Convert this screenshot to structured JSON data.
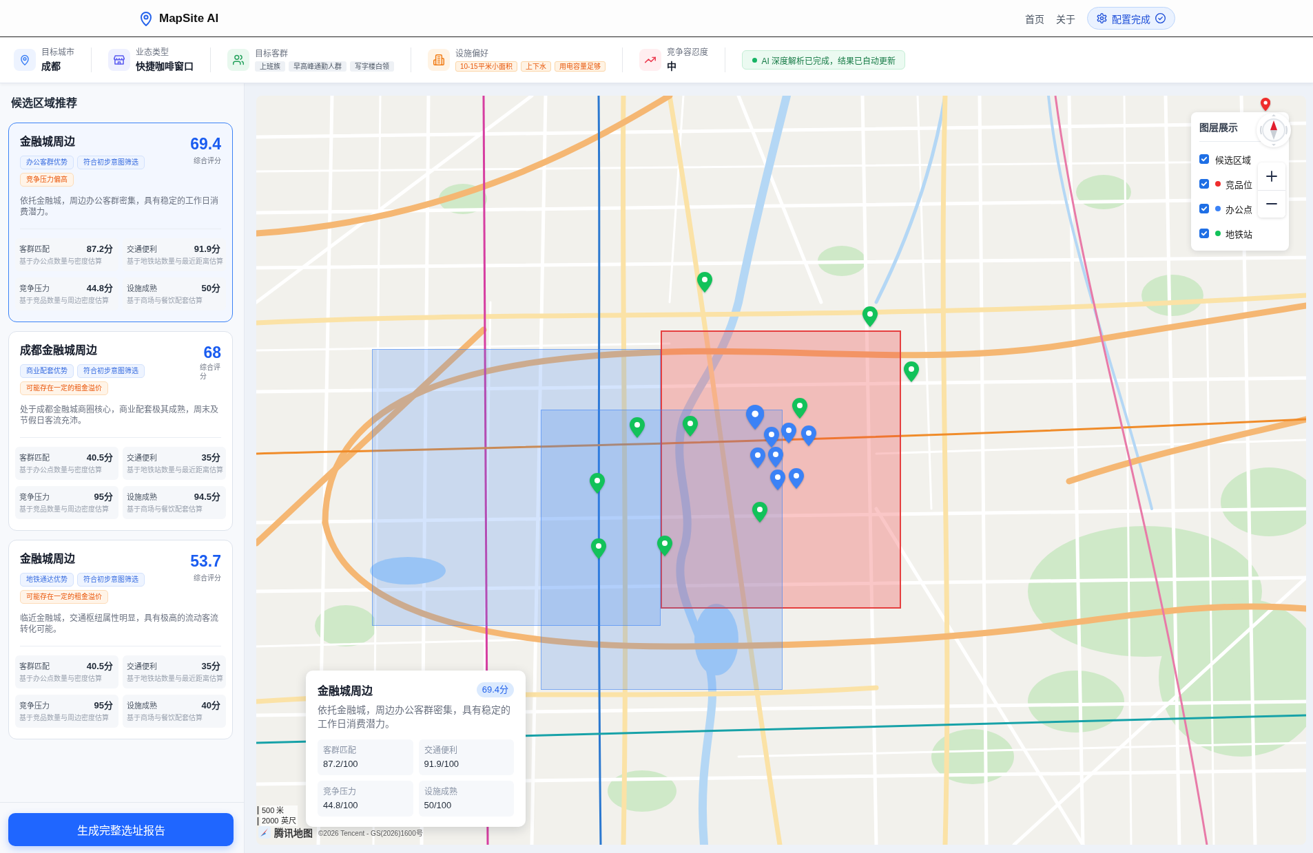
{
  "header": {
    "logo": "MapSite AI",
    "nav": [
      "首页",
      "关于"
    ],
    "status_button": "配置完成"
  },
  "summary_bar": {
    "items": [
      {
        "kind": "value",
        "label": "目标城市",
        "value": "成都"
      },
      {
        "kind": "value",
        "label": "业态类型",
        "value": "快捷咖啡窗口"
      },
      {
        "kind": "tags",
        "label": "目标客群",
        "tags": [
          "上班族",
          "早高峰通勤人群",
          "写字楼白领"
        ]
      },
      {
        "kind": "tags",
        "label": "设施偏好",
        "tags": [
          "10-15平米小面积",
          "上下水",
          "用电容量足够"
        ]
      },
      {
        "kind": "value",
        "label": "竞争容忍度",
        "value": "中"
      }
    ],
    "status": "AI 深度解析已完成，结果已自动更新"
  },
  "sidebar": {
    "title": "候选区域推荐",
    "cards": [
      {
        "selected": true,
        "title": "金融城周边",
        "score": "69.4",
        "score_label": "综合评分",
        "tags": [
          {
            "text": "办公客群优势",
            "kind": "highlight"
          },
          {
            "text": "符合初步意图筛选",
            "kind": "highlight"
          },
          {
            "text": "竞争压力偏高",
            "kind": "warning"
          }
        ],
        "description": "依托金融城，周边办公客群密集，具有稳定的工作日消费潜力。",
        "metrics": [
          {
            "label": "客群匹配",
            "value": "87.2分",
            "note": "基于办公点数量与密度估算"
          },
          {
            "label": "交通便利",
            "value": "91.9分",
            "note": "基于地铁站数量与最近距离估算"
          },
          {
            "label": "竞争压力",
            "value": "44.8分",
            "note": "基于竞品数量与周边密度估算"
          },
          {
            "label": "设施成熟",
            "value": "50分",
            "note": "基于商场与餐饮配套估算"
          }
        ]
      },
      {
        "selected": false,
        "title": "成都金融城周边",
        "score": "68",
        "score_label": "综合评分",
        "tags": [
          {
            "text": "商业配套优势",
            "kind": "highlight"
          },
          {
            "text": "符合初步意图筛选",
            "kind": "highlight"
          },
          {
            "text": "可能存在一定的租金溢价",
            "kind": "warning"
          }
        ],
        "description": "处于成都金融城商圈核心，商业配套极其成熟，周末及节假日客流充沛。",
        "metrics": [
          {
            "label": "客群匹配",
            "value": "40.5分",
            "note": "基于办公点数量与密度估算"
          },
          {
            "label": "交通便利",
            "value": "35分",
            "note": "基于地铁站数量与最近距离估算"
          },
          {
            "label": "竞争压力",
            "value": "95分",
            "note": "基于竞品数量与周边密度估算"
          },
          {
            "label": "设施成熟",
            "value": "94.5分",
            "note": "基于商场与餐饮配套估算"
          }
        ]
      },
      {
        "selected": false,
        "title": "金融城周边",
        "score": "53.7",
        "score_label": "综合评分",
        "tags": [
          {
            "text": "地铁通达优势",
            "kind": "highlight"
          },
          {
            "text": "符合初步意图筛选",
            "kind": "highlight"
          },
          {
            "text": "可能存在一定的租金溢价",
            "kind": "warning"
          }
        ],
        "description": "临近金融城，交通枢纽属性明显，具有极高的流动客流转化可能。",
        "metrics": [
          {
            "label": "客群匹配",
            "value": "40.5分",
            "note": "基于办公点数量与密度估算"
          },
          {
            "label": "交通便利",
            "value": "35分",
            "note": "基于地铁站数量与最近距离估算"
          },
          {
            "label": "竞争压力",
            "value": "95分",
            "note": "基于竞品数量与周边密度估算"
          },
          {
            "label": "设施成熟",
            "value": "40分",
            "note": "基于商场与餐饮配套估算"
          }
        ]
      }
    ],
    "report_button": "生成完整选址报告"
  },
  "map": {
    "layer_panel": {
      "title": "图层展示",
      "layers": [
        {
          "label": "候选区域",
          "checked": true
        },
        {
          "label": "竞品位",
          "checked": true,
          "color": "#ef2d2d"
        },
        {
          "label": "办公点",
          "checked": true,
          "color": "#3b82f6"
        },
        {
          "label": "地铁站",
          "checked": true,
          "color": "#12c25a"
        }
      ]
    },
    "popup": {
      "title": "金融城周边",
      "score": "69.4分",
      "description": "依托金融城，周边办公客群密集，具有稳定的工作日消费潜力。",
      "metrics": [
        {
          "label": "客群匹配",
          "value": "87.2/100"
        },
        {
          "label": "交通便利",
          "value": "91.9/100"
        },
        {
          "label": "竞争压力",
          "value": "44.8/100"
        },
        {
          "label": "设施成熟",
          "value": "50/100"
        }
      ]
    },
    "scale": [
      "500 米",
      "2000 英尺"
    ],
    "logo": "腾讯地图",
    "copyright": "©2026 Tencent - GS(2026)1600号"
  }
}
